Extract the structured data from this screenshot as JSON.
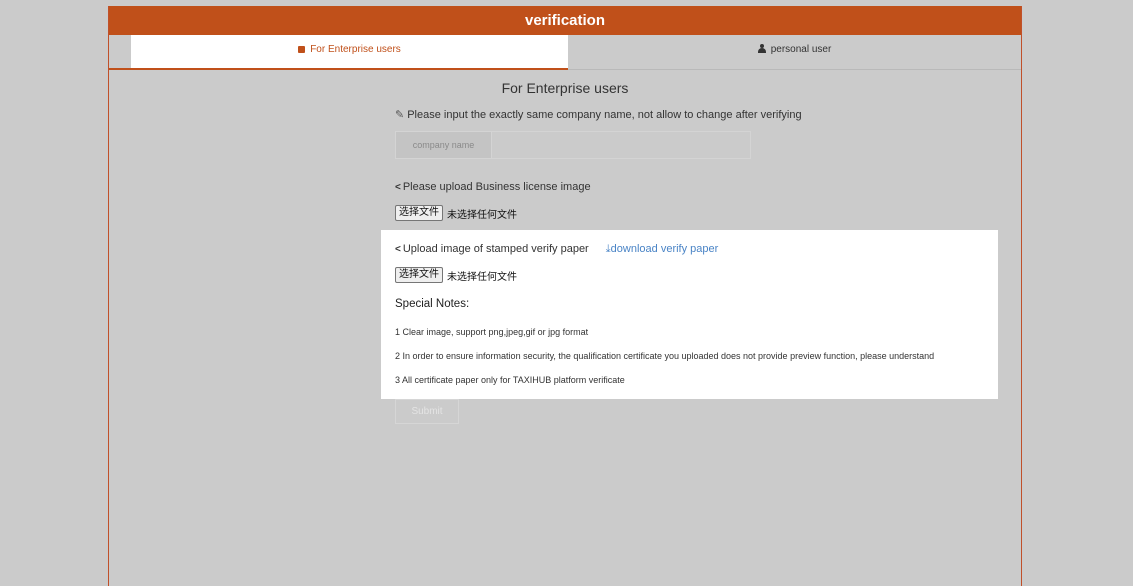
{
  "header": {
    "title": "verification"
  },
  "tabs": {
    "enterprise": "For Enterprise users",
    "personal": "personal user"
  },
  "form": {
    "heading": "For Enterprise users",
    "company_hint": "Please input the exactly same company name, not allow to change after verifying",
    "company_label": "company name",
    "company_value": "",
    "license_label": "Please upload Business license image",
    "file_button": "选择文件",
    "no_file": "未选择任何文件",
    "stamp_label": "Upload image of stamped verify paper",
    "download_link": "download verify paper",
    "stamp_file_button": "选择文件",
    "stamp_no_file": "未选择任何文件",
    "notes_title": "Special Notes:",
    "notes": [
      "1 Clear image, support png,jpeg,gif or jpg format",
      "2 In order to ensure information security, the qualification certificate you uploaded does not provide preview function, please understand",
      "3 All certificate paper only for TAXIHUB platform verificate"
    ],
    "submit": "Submit"
  },
  "colors": {
    "accent": "#c0501a",
    "link": "#4a84c6",
    "background": "#cbcbcb"
  },
  "icons": {
    "enterprise_tab": "building-icon",
    "personal_tab": "person-icon",
    "company_hint": "pencil-icon",
    "license_label": "share-icon",
    "stamp_label": "share-icon",
    "download": "download-icon"
  }
}
